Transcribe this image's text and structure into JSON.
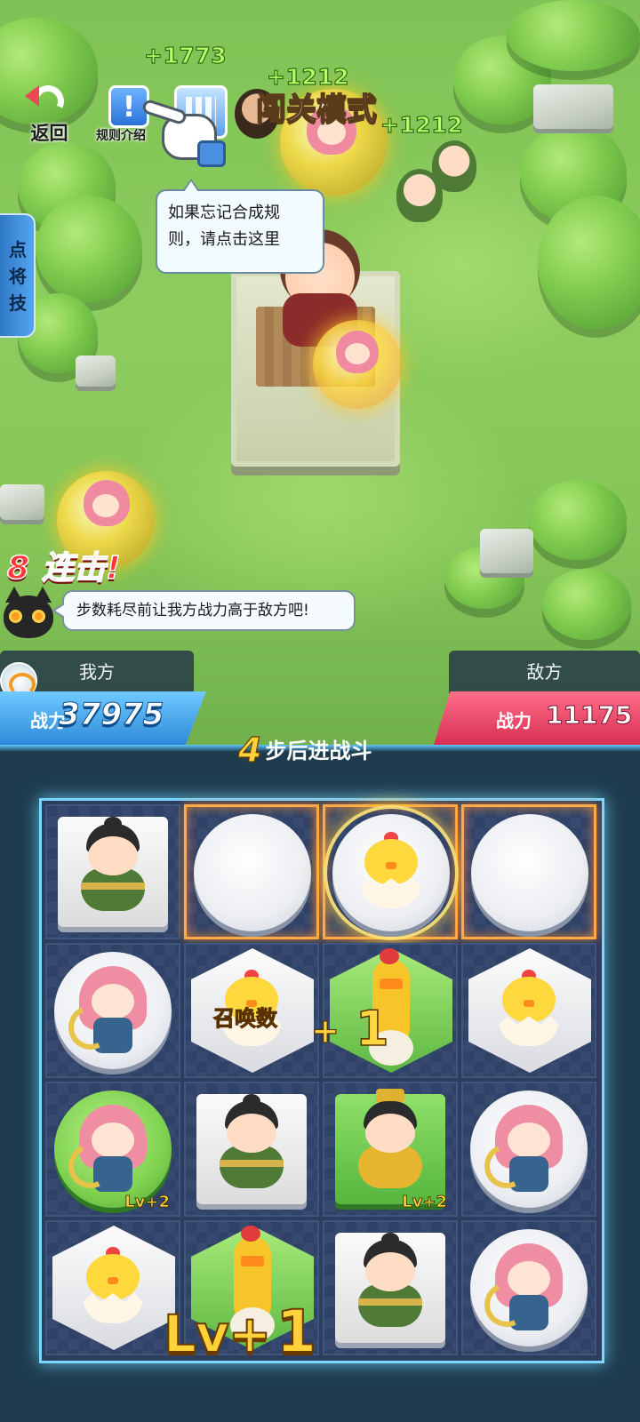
{
  "field": {
    "floating_numbers": [
      "+1773",
      "+1212",
      "+1212"
    ],
    "mode_title": "闯关模式"
  },
  "top_buttons": {
    "back_label": "返回",
    "rules_label": "规则介绍"
  },
  "tips": {
    "rules_hint_line1": "如果忘记合成规",
    "rules_hint_line2": "则，请点击这里",
    "goal_hint": "步数耗尽前让我方战力高于敌方吧!"
  },
  "skill_tab": {
    "label": [
      "点",
      "将",
      "技"
    ]
  },
  "combo": {
    "count": "8",
    "label": "连击!"
  },
  "score": {
    "ours_label": "我方",
    "enemy_label": "敌方",
    "ours_power_label": "战力",
    "ours_power": "37975",
    "enemy_power_label": "战力",
    "enemy_power": "11175"
  },
  "steps": {
    "count": "4",
    "text": "步后进战斗"
  },
  "board": {
    "summon_label": "召唤数",
    "summon_plus": "+",
    "summon_value": "1",
    "lv_small_1": "Lv+2",
    "lv_small_2": "Lv+2",
    "lv_big_prefix": "Lv+",
    "lv_big_value": "1",
    "cells": [
      [
        "soldier",
        "empty",
        "chick-selected",
        "empty"
      ],
      [
        "girl",
        "chick-hex",
        "rooster-hex",
        "chick-hex"
      ],
      [
        "girl-lv2",
        "soldier",
        "general-lv2",
        "girl"
      ],
      [
        "chick-hex",
        "rooster-hex",
        "soldier",
        "girl"
      ]
    ]
  },
  "colors": {
    "ours_accent": "#2d8ad8",
    "enemy_accent": "#d82e52",
    "grid_glow": "#7dd6ff",
    "highlight": "#ffa94a"
  }
}
